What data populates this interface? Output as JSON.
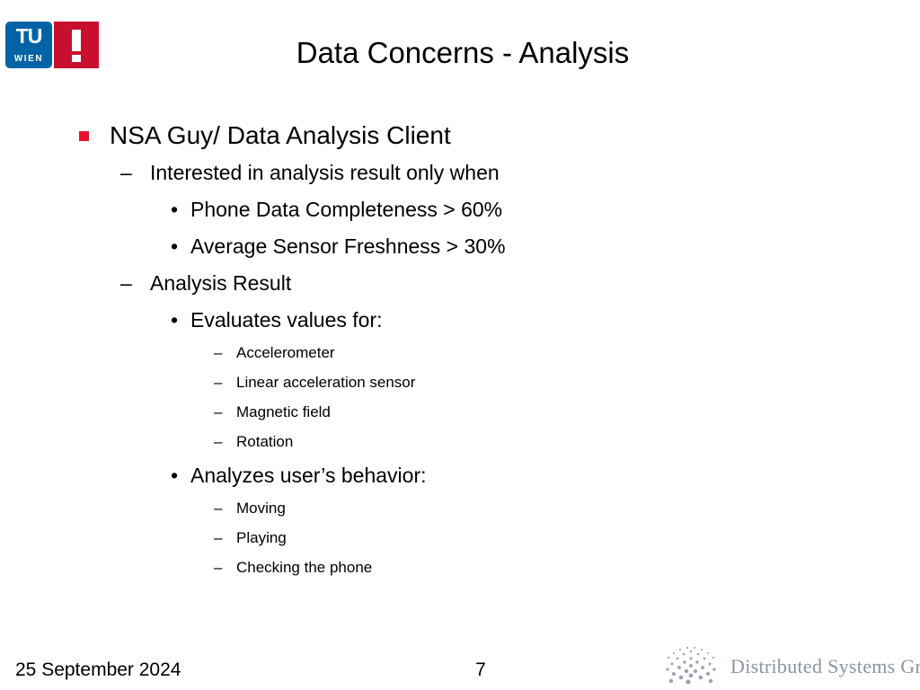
{
  "slide": {
    "title": "Data Concerns - Analysis",
    "background_color": "#ffffff",
    "text_color": "#000000"
  },
  "logo": {
    "name": "tu-wien-logo",
    "letters": "TU",
    "city": "WIEN",
    "blue": "#0063a6",
    "red": "#c8102e",
    "exclamation": "!"
  },
  "content": {
    "bullet_color": "#e8112d",
    "items": [
      {
        "level": 1,
        "marker": "square",
        "text": "NSA Guy/ Data Analysis Client"
      },
      {
        "level": 2,
        "marker": "–",
        "text": "Interested in analysis result only when"
      },
      {
        "level": 3,
        "marker": "•",
        "text": "Phone Data Completeness > 60%"
      },
      {
        "level": 3,
        "marker": "•",
        "text": "Average Sensor Freshness > 30%"
      },
      {
        "level": 2,
        "marker": "–",
        "text": "Analysis Result"
      },
      {
        "level": 3,
        "marker": "•",
        "text": "Evaluates values for:"
      },
      {
        "level": 4,
        "marker": "–",
        "text": "Accelerometer"
      },
      {
        "level": 4,
        "marker": "–",
        "text": "Linear acceleration sensor"
      },
      {
        "level": 4,
        "marker": "–",
        "text": "Magnetic field"
      },
      {
        "level": 4,
        "marker": "–",
        "text": "Rotation"
      },
      {
        "level": 3,
        "marker": "•",
        "text": "Analyzes user’s behavior:"
      },
      {
        "level": 4,
        "marker": "–",
        "text": "Moving"
      },
      {
        "level": 4,
        "marker": "–",
        "text": "Playing"
      },
      {
        "level": 4,
        "marker": "–",
        "text": "Checking the phone"
      }
    ]
  },
  "footer": {
    "date": "25 September 2024",
    "page_number": "7",
    "org_logo": {
      "name": "distributed-systems-group-logo",
      "text": "Distributed Systems Group",
      "color": "#8c94a4"
    }
  }
}
